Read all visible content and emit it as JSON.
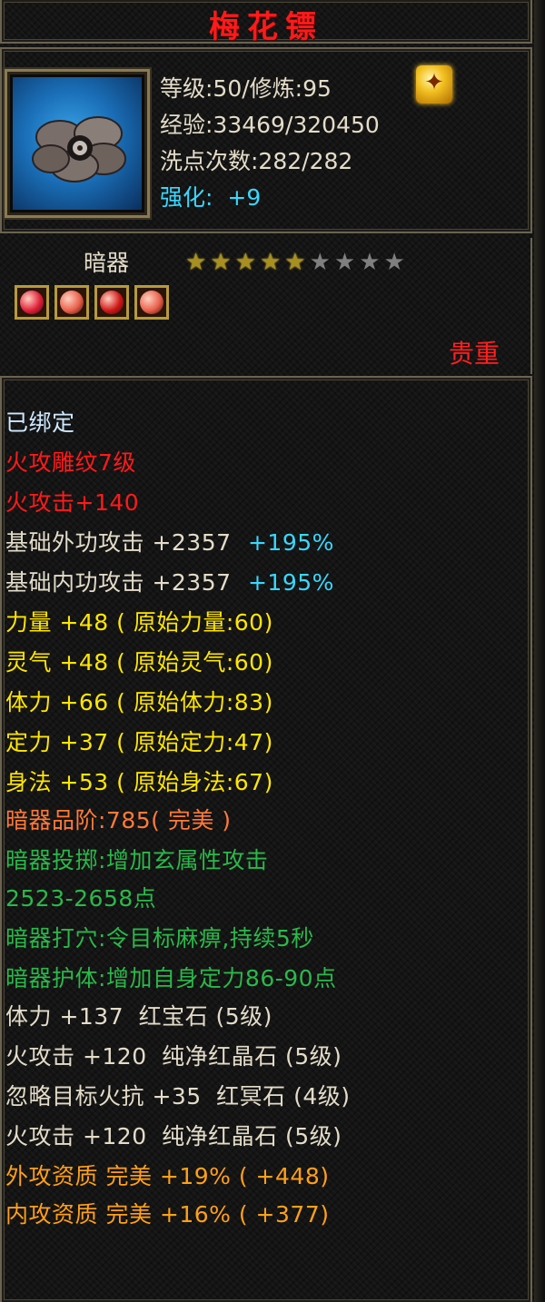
{
  "title": "梅花镖",
  "header": {
    "level": "等级:50/修炼:95",
    "exp": "经验:33469/320450",
    "wash": "洗点次数:282/282",
    "enhance_label": "强化:",
    "enhance_value": "+9"
  },
  "item_type": "暗器",
  "stars": {
    "lit": 5,
    "total": 9
  },
  "gems": [
    {
      "icon": "red-gem-icon",
      "color": "#e0203a"
    },
    {
      "icon": "pink-gem-icon",
      "color": "#e8604a"
    },
    {
      "icon": "ruby-gem-icon",
      "color": "#d01818"
    },
    {
      "icon": "pink-gem-icon",
      "color": "#e8604a"
    }
  ],
  "rarity": "贵重",
  "attrs": {
    "bound": "已绑定",
    "engrave": "火攻雕纹7级",
    "fire_attack": "火攻击+140",
    "ext_base": "基础外功攻击 +2357",
    "ext_pct": "+195%",
    "int_base": "基础内功攻击 +2357",
    "int_pct": "+195%",
    "strength": "力量 +48 ( 原始力量:60)",
    "spirit": "灵气 +48 ( 原始灵气:60)",
    "stamina": "体力 +66 ( 原始体力:83)",
    "focus": "定力 +37 ( 原始定力:47)",
    "agility": "身法 +53 ( 原始身法:67)",
    "grade_label": "暗器品阶:785",
    "grade_value": "( 完美 )",
    "throw_1": "暗器投掷:增加玄属性攻击",
    "throw_2": "2523-2658点",
    "acupoint": "暗器打穴:令目标麻痹,持续5秒",
    "guard": "暗器护体:增加自身定力86-90点",
    "gem1_stat": "体力 +137",
    "gem1_name": "红宝石 (5级)",
    "gem2_stat": "火攻击 +120",
    "gem2_name": "纯净红晶石 (5级)",
    "gem3_stat": "忽略目标火抗 +35",
    "gem3_name": "红冥石 (4级)",
    "gem4_stat": "火攻击 +120",
    "gem4_name": "纯净红晶石 (5级)",
    "ext_quality": "外攻资质  完美 +19% ( +448)",
    "int_quality": "内攻资质  完美 +16% ( +377)"
  }
}
